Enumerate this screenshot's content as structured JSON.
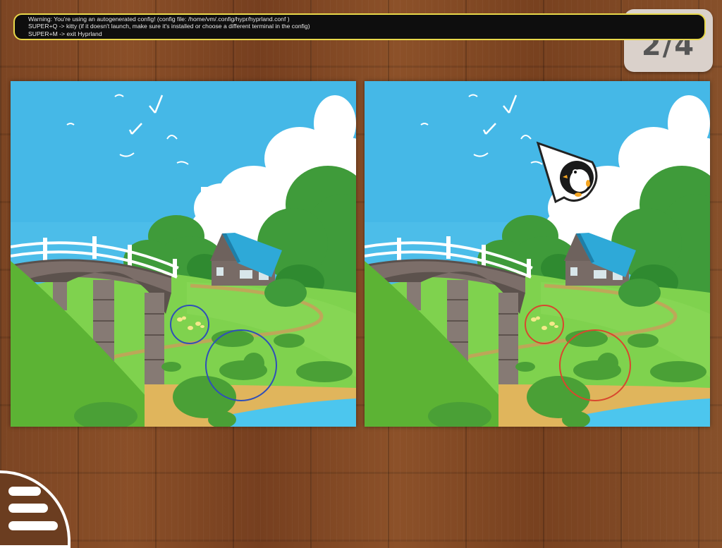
{
  "notification": {
    "line1": "Warning: You're using an autogenerated config! (config file: /home/vm/.config/hypr/hyprland.conf )",
    "line2": "SUPER+Q -> kitty (if it doesn't launch, make sure it's installed or choose a different terminal in the config)",
    "line3": "SUPER+M -> exit Hyprland"
  },
  "game": {
    "progress_label": "2/4",
    "differences_found": 2,
    "differences_total": 4
  },
  "colors": {
    "left_marker": "#2f4fb8",
    "right_marker": "#d8472e",
    "sky": "#4cbde9",
    "grass": "#7fd24e",
    "roof": "#2ea9d8"
  },
  "icons": {
    "menu": "hamburger-menu-icon",
    "cursor": "penguin-arrow-cursor-icon"
  }
}
